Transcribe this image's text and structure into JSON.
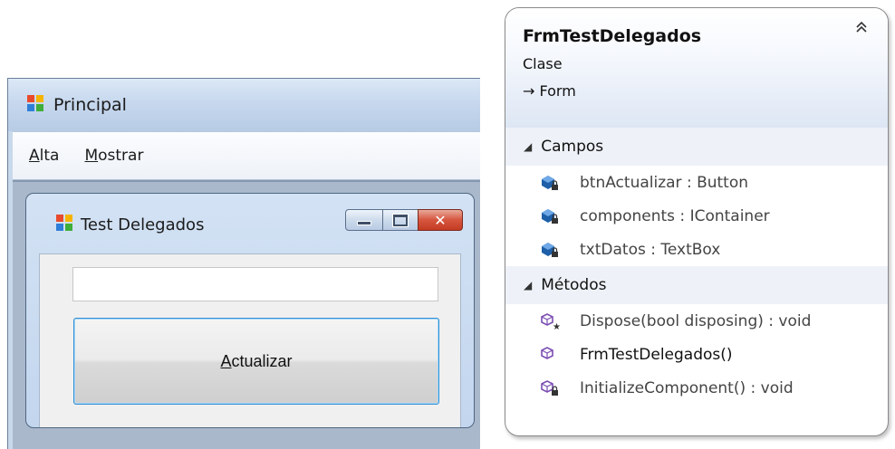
{
  "principal_window": {
    "title": "Principal",
    "menu": [
      {
        "accel": "A",
        "rest": "lta"
      },
      {
        "accel": "M",
        "rest": "ostrar"
      }
    ]
  },
  "child_window": {
    "title": "Test Delegados",
    "textbox_value": "",
    "button": {
      "accel": "A",
      "rest": "ctualizar"
    }
  },
  "class_diagram": {
    "name": "FrmTestDelegados",
    "kind": "Clase",
    "base": "→ Form",
    "sections": [
      {
        "title": "Campos",
        "members": [
          {
            "text": "btnActualizar : Button",
            "icon": "private-field-icon"
          },
          {
            "text": "components : IContainer",
            "icon": "private-field-icon"
          },
          {
            "text": "txtDatos : TextBox",
            "icon": "private-field-icon"
          }
        ]
      },
      {
        "title": "Métodos",
        "members": [
          {
            "text": "Dispose(bool disposing) : void",
            "icon": "protected-method-icon"
          },
          {
            "text": "FrmTestDelegados()",
            "icon": "public-method-icon"
          },
          {
            "text": "InitializeComponent() : void",
            "icon": "private-method-icon"
          }
        ]
      }
    ]
  },
  "colors": {
    "field_icon": "#1e5fa8",
    "method_icon": "#7b4db3",
    "button_focus": "#2f8fd4"
  }
}
